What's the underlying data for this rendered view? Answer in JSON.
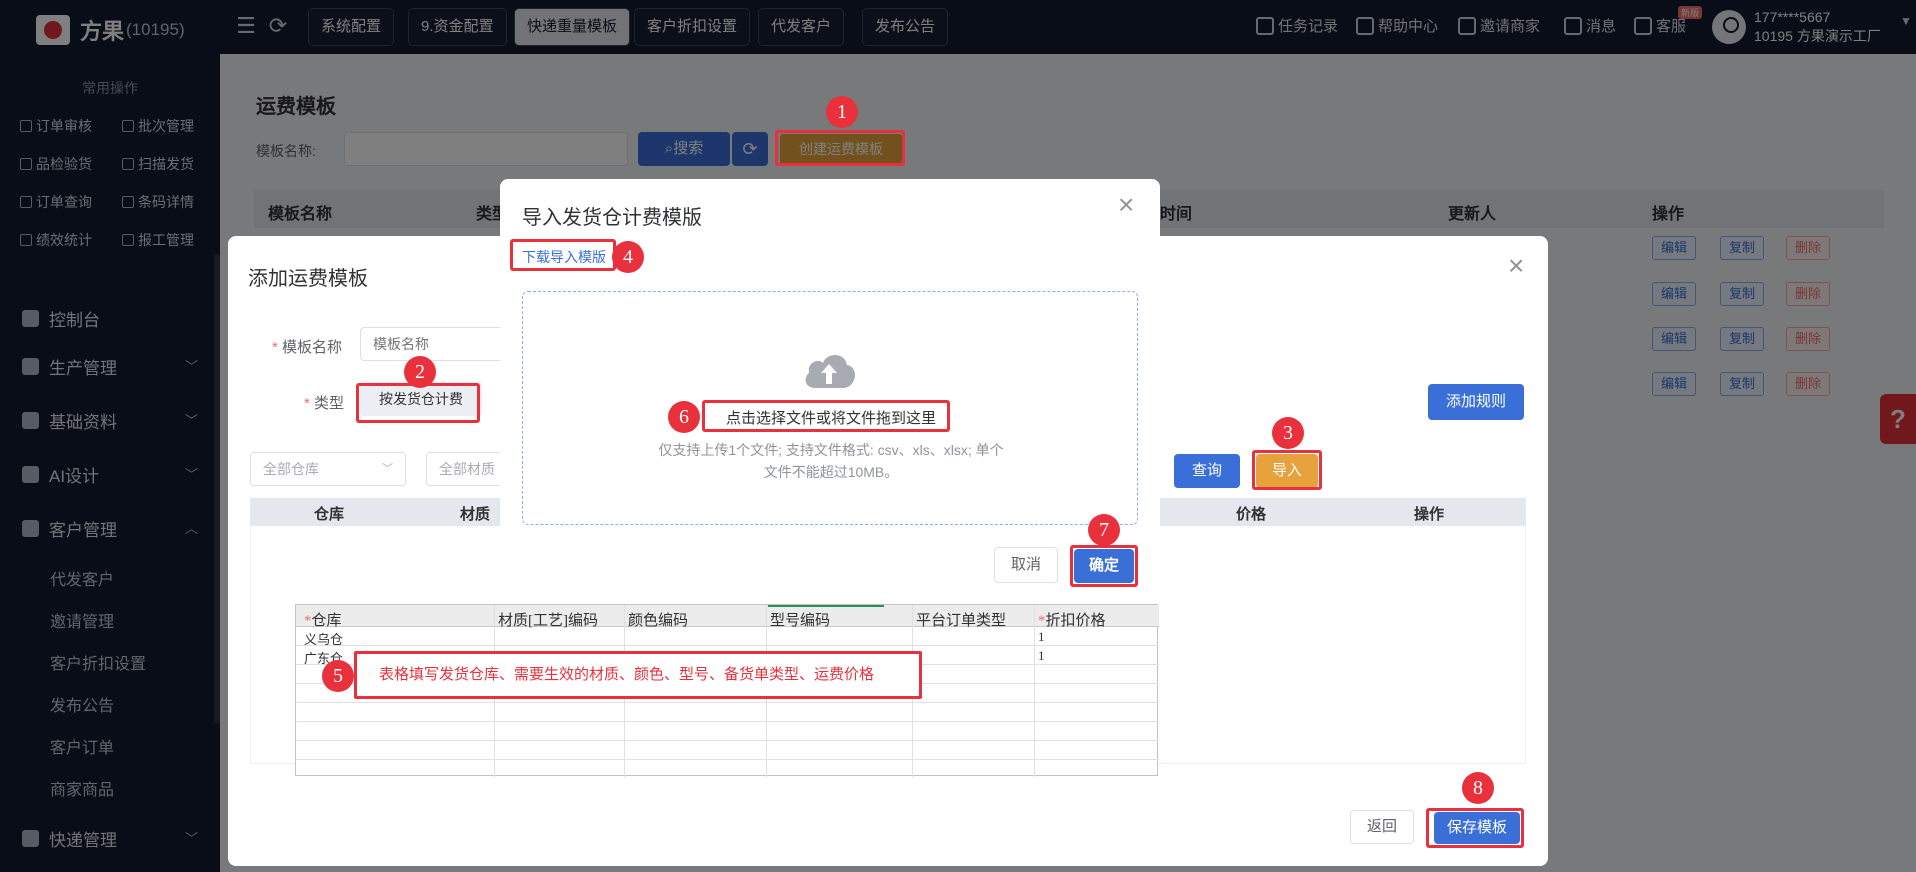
{
  "topbar": {
    "brand": "方果",
    "account_count": "(10195)",
    "tabs": [
      {
        "label": "系统配置"
      },
      {
        "label": "9.资金配置"
      },
      {
        "label": "快递重量模板"
      },
      {
        "label": "客户折扣设置"
      },
      {
        "label": "代发客户"
      },
      {
        "label": "发布公告"
      }
    ],
    "right": {
      "tasks": "任务记录",
      "help": "帮助中心",
      "invite": "邀请商家",
      "messages": "消息",
      "service": "客服",
      "hot_badge": "新版"
    },
    "user": {
      "phone": "177****5667",
      "company": "10195 方果演示工厂"
    }
  },
  "sidebar": {
    "common_title": "常用操作",
    "quick": [
      "订单审核",
      "批次管理",
      "品检验货",
      "扫描发货",
      "订单查询",
      "条码详情",
      "绩效统计",
      "报工管理"
    ],
    "menus": [
      {
        "label": "控制台"
      },
      {
        "label": "生产管理"
      },
      {
        "label": "基础资料"
      },
      {
        "label": "AI设计"
      },
      {
        "label": "客户管理"
      }
    ],
    "sub_items": [
      "代发客户",
      "邀请管理",
      "客户折扣设置",
      "发布公告",
      "客户订单",
      "商家商品"
    ],
    "last_menu": "快递管理"
  },
  "background_page": {
    "title": "运费模板",
    "name_label": "模板名称:",
    "search_label": "搜索",
    "create_label": "创建运费模板",
    "columns": [
      "模板名称",
      "类型",
      "时间",
      "更新人",
      "操作"
    ],
    "row_actions": {
      "edit": "编辑",
      "copy": "复制",
      "delete": "删除"
    }
  },
  "add_dialog": {
    "title": "添加运费模板",
    "name_label": "模板名称",
    "name_placeholder": "模板名称",
    "type_label": "类型",
    "type_value": "按发货仓计费",
    "add_rule": "添加规则",
    "filter_warehouse": "全部仓库",
    "filter_material": "全部材质",
    "query": "查询",
    "import": "导入",
    "columns": [
      "仓库",
      "材质",
      "价格",
      "操作"
    ],
    "back": "返回",
    "save": "保存模板"
  },
  "import_dialog": {
    "title": "导入发货仓计费模版",
    "download_link": "下载导入模版",
    "drop_text": "点击选择文件或将文件拖到这里",
    "tip_line1": "仅支持上传1个文件;  支持文件格式: csv、xls、xlsx;  单个",
    "tip_line2": "文件不能超过10MB。",
    "cancel": "取消",
    "confirm": "确定"
  },
  "spreadsheet": {
    "headers": [
      "仓库",
      "材质[工艺]编码",
      "颜色编码",
      "型号编码",
      "平台订单类型",
      "折扣价格"
    ],
    "required_mark": "*",
    "rows": [
      {
        "warehouse": "义乌仓",
        "price": "1"
      },
      {
        "warehouse": "广东仓",
        "price": "1"
      }
    ]
  },
  "annotations": {
    "step_numbers": [
      "1",
      "2",
      "3",
      "4",
      "5",
      "6",
      "7",
      "8"
    ],
    "note5": "表格填写发货仓库、需要生效的材质、颜色、型号、备货单类型、运费价格"
  },
  "colors": {
    "topbar_bg": "#111a2e",
    "primary": "#3a6fd8",
    "warning": "#e6a23c",
    "annotation_red": "#e8313c"
  }
}
